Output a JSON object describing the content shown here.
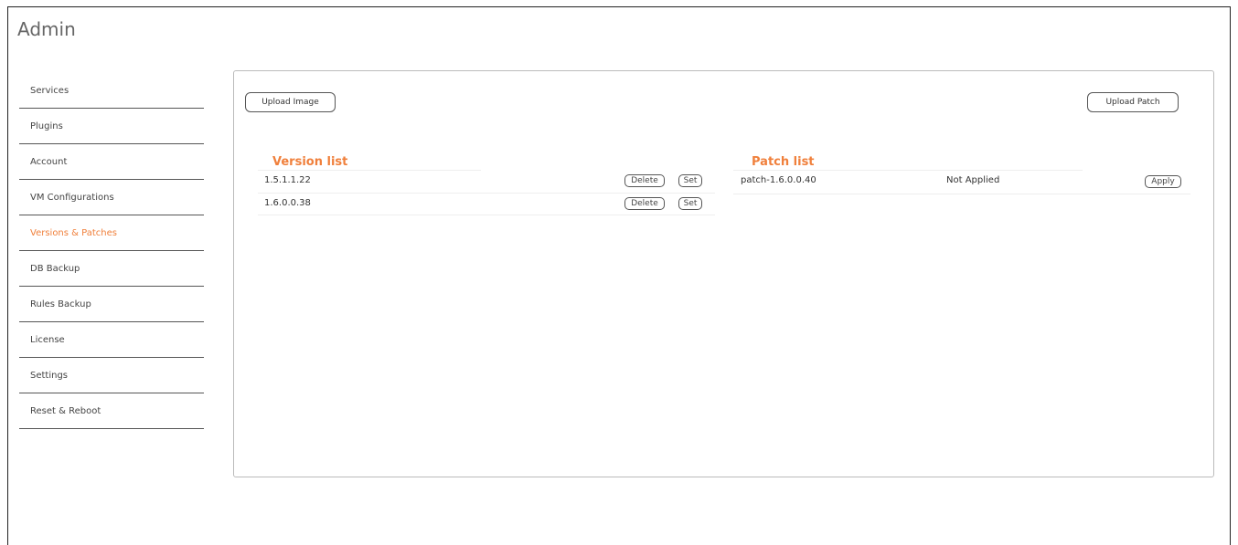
{
  "app": {
    "title": "Admin"
  },
  "sidebar": {
    "items": [
      {
        "label": "Services"
      },
      {
        "label": "Plugins"
      },
      {
        "label": "Account"
      },
      {
        "label": "VM Configurations"
      },
      {
        "label": "Versions & Patches",
        "active": true
      },
      {
        "label": "DB Backup"
      },
      {
        "label": "Rules Backup"
      },
      {
        "label": "License"
      },
      {
        "label": "Settings"
      },
      {
        "label": "Reset & Reboot"
      }
    ]
  },
  "toolbar": {
    "upload_image_label": "Upload Image",
    "upload_patch_label": "Upload Patch"
  },
  "versions": {
    "title": "Version list",
    "rows": [
      {
        "version": "1.5.1.1.22",
        "delete_label": "Delete",
        "set_label": "Set"
      },
      {
        "version": "1.6.0.0.38",
        "delete_label": "Delete",
        "set_label": "Set"
      }
    ]
  },
  "patches": {
    "title": "Patch list",
    "rows": [
      {
        "name": "patch-1.6.0.0.40",
        "status": "Not Applied",
        "apply_label": "Apply"
      }
    ]
  },
  "colors": {
    "accent": "#f0803c",
    "border": "#555555",
    "panel_border": "#bbbbbb"
  }
}
